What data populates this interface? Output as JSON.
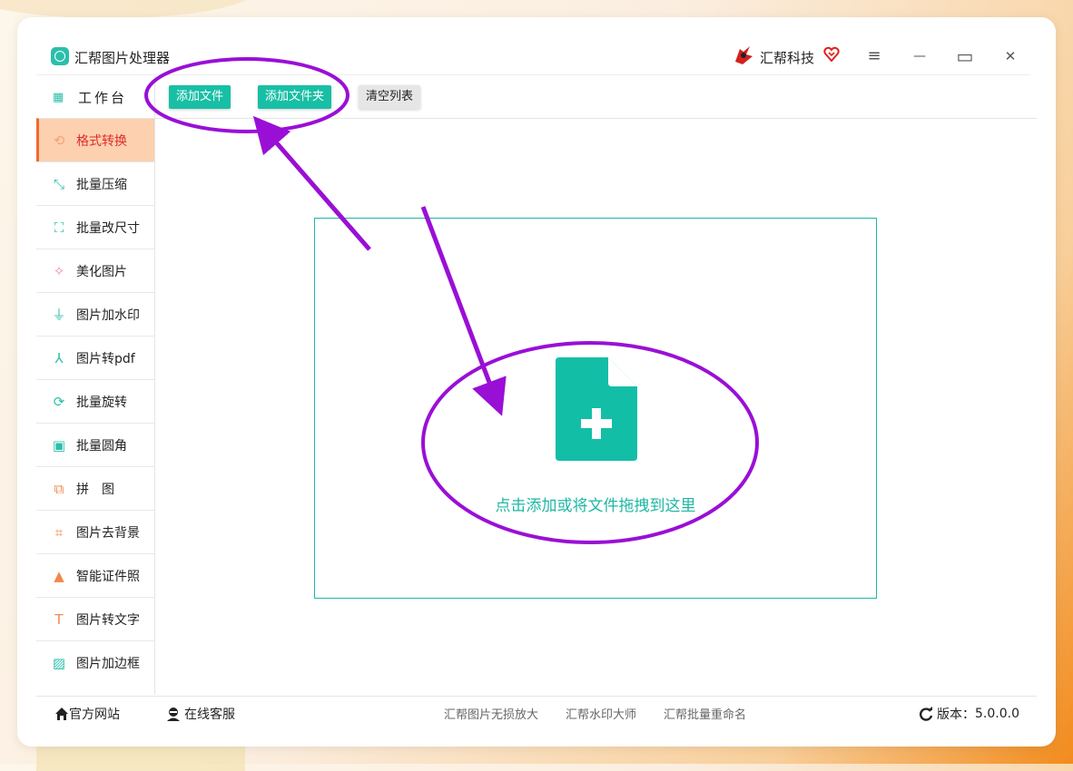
{
  "app": {
    "title": "汇帮图片处理器",
    "brand": "汇帮科技"
  },
  "window_controls": {
    "menu": "≡",
    "minimize": "—",
    "maximize": "▭",
    "close": "✕"
  },
  "sidebar": {
    "workbench": "工作台",
    "items": [
      {
        "label": "格式转换",
        "icon": "format-convert-icon",
        "active": true,
        "color": "#f4a27a"
      },
      {
        "label": "批量压缩",
        "icon": "compress-icon",
        "color": "#2bbfaa"
      },
      {
        "label": "批量改尺寸",
        "icon": "resize-icon",
        "color": "#2bbfaa"
      },
      {
        "label": "美化图片",
        "icon": "beautify-icon",
        "color": "#f08aa0"
      },
      {
        "label": "图片加水印",
        "icon": "watermark-icon",
        "color": "#2bbfaa"
      },
      {
        "label": "图片转pdf",
        "icon": "pdf-icon",
        "color": "#2bbfaa"
      },
      {
        "label": "批量旋转",
        "icon": "rotate-icon",
        "color": "#2bbfaa"
      },
      {
        "label": "批量圆角",
        "icon": "rounded-corner-icon",
        "color": "#2bbfaa"
      },
      {
        "label": "拼　图",
        "icon": "puzzle-icon",
        "color": "#f0884a"
      },
      {
        "label": "图片去背景",
        "icon": "crop-icon",
        "color": "#f0884a"
      },
      {
        "label": "智能证件照",
        "icon": "person-icon",
        "color": "#f0884a"
      },
      {
        "label": "图片转文字",
        "icon": "text-icon",
        "color": "#f0884a"
      },
      {
        "label": "图片加边框",
        "icon": "frame-icon",
        "color": "#2bbfaa"
      }
    ]
  },
  "toolbar": {
    "add_file": "添加文件",
    "add_folder": "添加文件夹",
    "clear_list": "清空列表"
  },
  "dropzone": {
    "text": "点击添加或将文件拖拽到这里"
  },
  "footer": {
    "website": "官方网站",
    "support": "在线客服",
    "links": [
      "汇帮图片无损放大",
      "汇帮水印大师",
      "汇帮批量重命名"
    ],
    "version_label": "版本：",
    "version": "5.0.0.0"
  },
  "colors": {
    "accent": "#18bfa5",
    "active_bg": "#fdd0b0",
    "active_text": "#e02b2b",
    "annotation": "#9a0fd6"
  }
}
